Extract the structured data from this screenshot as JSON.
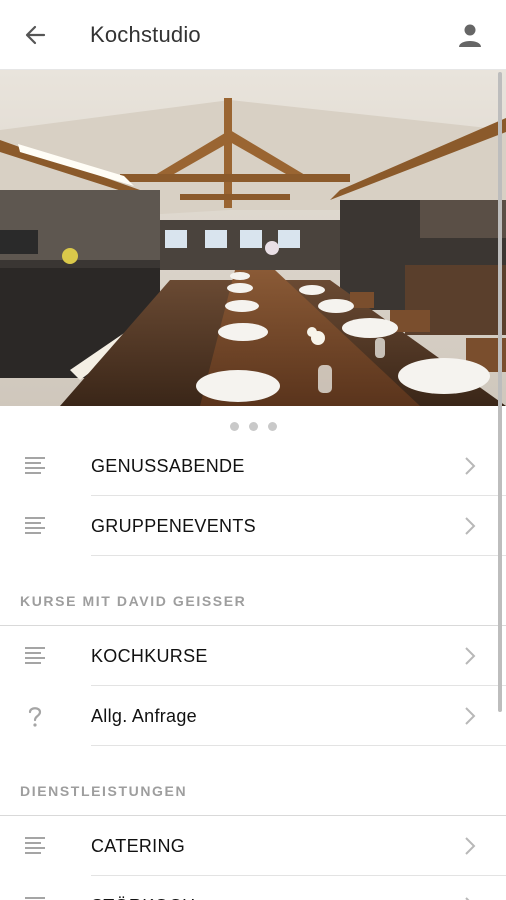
{
  "appbar": {
    "title": "Kochstudio",
    "back_icon": "arrow-left-icon",
    "profile_icon": "person-icon"
  },
  "hero": {
    "description_icon": "photo",
    "carousel_dots": 3
  },
  "menu": [
    {
      "label": "GENUSSABENDE",
      "icon": "list-icon"
    },
    {
      "label": "GRUPPENEVENTS",
      "icon": "list-icon"
    }
  ],
  "sections": [
    {
      "title": "KURSE MIT DAVID GEISSER",
      "items": [
        {
          "label": "KOCHKURSE",
          "icon": "list-icon"
        },
        {
          "label": "Allg. Anfrage",
          "icon": "question-icon"
        }
      ]
    },
    {
      "title": "DIENSTLEISTUNGEN",
      "items": [
        {
          "label": "CATERING",
          "icon": "list-icon"
        },
        {
          "label": "STÖRKOCH",
          "icon": "list-icon"
        }
      ]
    }
  ],
  "colors": {
    "text": "#111111",
    "muted": "#9e9e9e",
    "icon": "#9a9a9a",
    "separator": "#e3e3e3"
  }
}
